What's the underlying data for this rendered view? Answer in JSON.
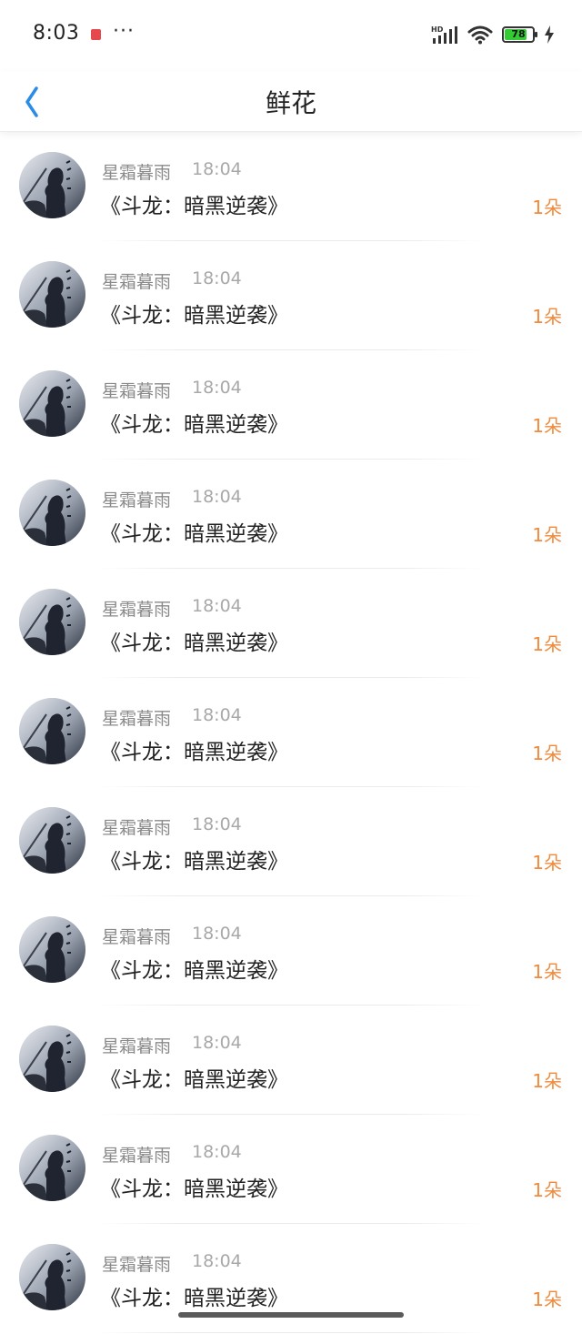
{
  "status_bar": {
    "time": "8:03",
    "more": "···",
    "network_label": "HD",
    "battery_level": "78",
    "icons": [
      "notification-icon",
      "more-icon",
      "signal-icon",
      "wifi-icon",
      "battery-icon",
      "charging-icon"
    ]
  },
  "header": {
    "title": "鲜花",
    "back_icon": "chevron-left-icon"
  },
  "colors": {
    "accent": "#2b8ce8",
    "count": "#f08a3c",
    "name": "#8a8a8a",
    "time": "#a8a8a8",
    "title": "#222222"
  },
  "items": [
    {
      "user": "星霜暮雨",
      "time": "18:04",
      "title": "《斗龙：暗黑逆袭》",
      "count": "1朵"
    },
    {
      "user": "星霜暮雨",
      "time": "18:04",
      "title": "《斗龙：暗黑逆袭》",
      "count": "1朵"
    },
    {
      "user": "星霜暮雨",
      "time": "18:04",
      "title": "《斗龙：暗黑逆袭》",
      "count": "1朵"
    },
    {
      "user": "星霜暮雨",
      "time": "18:04",
      "title": "《斗龙：暗黑逆袭》",
      "count": "1朵"
    },
    {
      "user": "星霜暮雨",
      "time": "18:04",
      "title": "《斗龙：暗黑逆袭》",
      "count": "1朵"
    },
    {
      "user": "星霜暮雨",
      "time": "18:04",
      "title": "《斗龙：暗黑逆袭》",
      "count": "1朵"
    },
    {
      "user": "星霜暮雨",
      "time": "18:04",
      "title": "《斗龙：暗黑逆袭》",
      "count": "1朵"
    },
    {
      "user": "星霜暮雨",
      "time": "18:04",
      "title": "《斗龙：暗黑逆袭》",
      "count": "1朵"
    },
    {
      "user": "星霜暮雨",
      "time": "18:04",
      "title": "《斗龙：暗黑逆袭》",
      "count": "1朵"
    },
    {
      "user": "星霜暮雨",
      "time": "18:04",
      "title": "《斗龙：暗黑逆袭》",
      "count": "1朵"
    },
    {
      "user": "星霜暮雨",
      "time": "18:04",
      "title": "《斗龙：暗黑逆袭》",
      "count": "1朵"
    }
  ]
}
